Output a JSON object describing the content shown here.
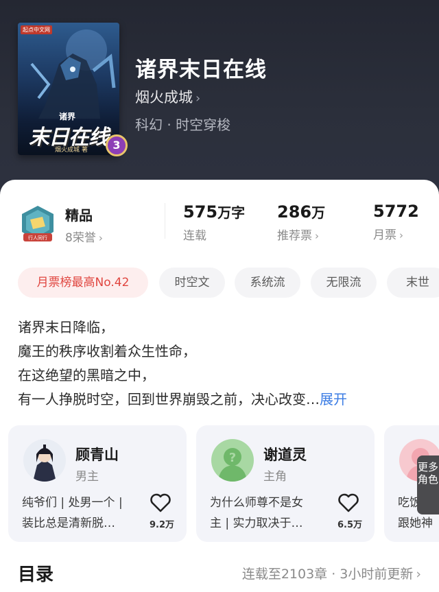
{
  "book": {
    "title": "诸界末日在线",
    "author": "烟火成城",
    "author_chevron": "›",
    "genre": "科幻 · 时空穿梭",
    "cover": {
      "tag": "起点中文网",
      "title_prefix": "诸界",
      "title": "末日在线",
      "author": "烟火成城 著"
    },
    "rank_badge": "3"
  },
  "honor": {
    "label": "精品",
    "sub": "8荣誉",
    "chevron": "›",
    "icon_text": "行人同行"
  },
  "stats": [
    {
      "num": "575",
      "unit": "万字",
      "label": "连载",
      "chevron": ""
    },
    {
      "num": "286",
      "unit": "万",
      "label": "推荐票",
      "chevron": "›"
    },
    {
      "num": "5772",
      "unit": "",
      "label": "月票",
      "chevron": "›"
    }
  ],
  "tags": [
    "月票榜最高No.42",
    "时空文",
    "系统流",
    "无限流",
    "末世"
  ],
  "synopsis": {
    "lines": [
      "诸界末日降临，",
      "魔王的秩序收割着众生性命，",
      "在这绝望的黑暗之中，",
      "有一人挣脱时空，回到世界崩毁之前，决心改变…"
    ],
    "expand": "展开"
  },
  "roles": [
    {
      "name": "顾青山",
      "type": "男主",
      "desc": [
        "纯爷们 | 处男一个 |",
        "装比总是清新脱…"
      ],
      "likes": "9.2万"
    },
    {
      "name": "谢道灵",
      "type": "主角",
      "desc": [
        "为什么师尊不是女",
        "主 | 实力取决于…"
      ],
      "likes": "6.5万"
    },
    {
      "name": "",
      "type": "",
      "desc": [
        "吃饭睡",
        "跟她神"
      ],
      "likes": ""
    }
  ],
  "more_roles": "更多角色",
  "toc": {
    "title": "目录",
    "status": "连载至2103章 · 3小时前更新",
    "chevron": "›"
  },
  "colors": {
    "hero_bg": "#2b2f3b",
    "accent_blue": "#3b7ce4",
    "hot_tag": "#e0453f",
    "role_card_bg": "#f3f4f9"
  }
}
